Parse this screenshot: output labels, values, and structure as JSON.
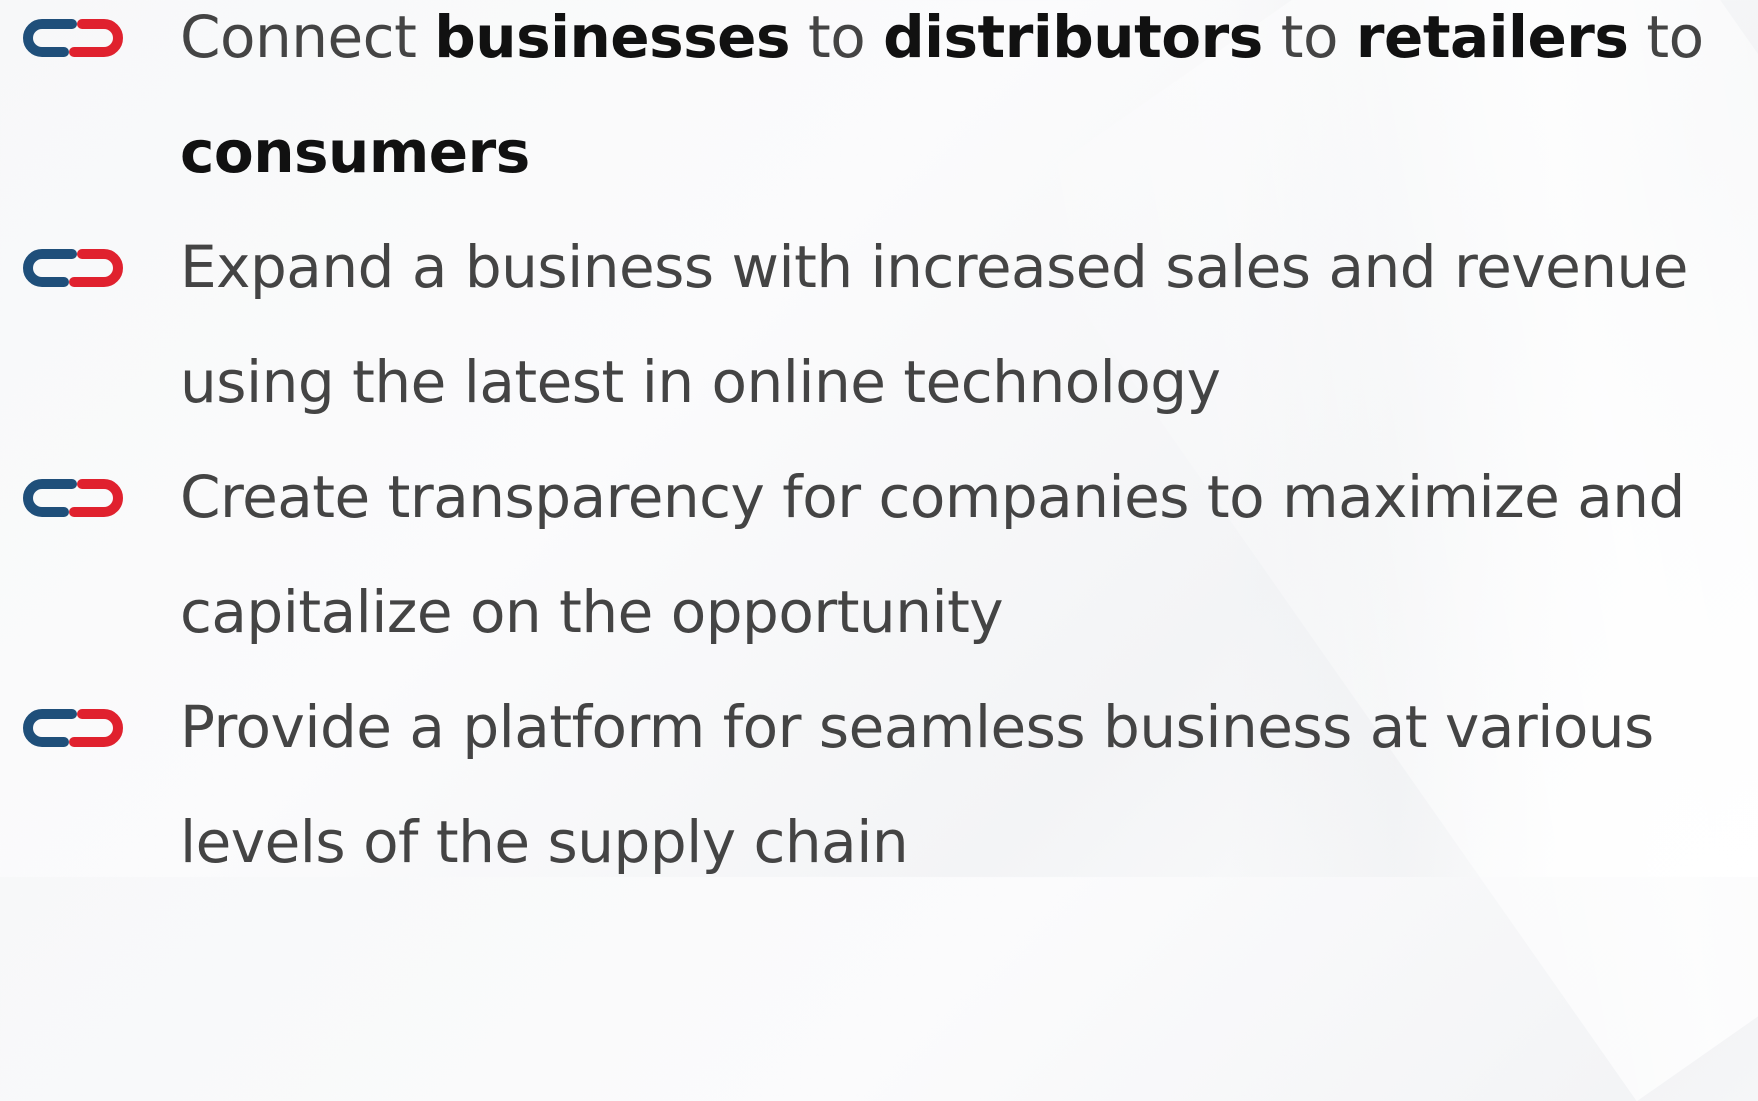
{
  "bullets": [
    {
      "parts": [
        {
          "text": "Connect ",
          "bold": false
        },
        {
          "text": "businesses",
          "bold": true
        },
        {
          "text": " to ",
          "bold": false
        },
        {
          "text": "distributors",
          "bold": true
        },
        {
          "text": " to ",
          "bold": false
        },
        {
          "text": "retailers",
          "bold": true
        },
        {
          "text": " to ",
          "bold": false
        },
        {
          "text": "consumers",
          "bold": true
        }
      ]
    },
    {
      "text": "Expand a business with increased sales and revenue using the latest in online technology"
    },
    {
      "text": "Create transparency for companies to maximize and capitalize on the opportunity"
    },
    {
      "text": "Provide a platform for seamless business at various levels of the supply chain"
    }
  ],
  "icon": {
    "name": "chain-link-icon",
    "colors": {
      "left_link": "#1f4f7a",
      "right_link": "#e0212e"
    }
  }
}
